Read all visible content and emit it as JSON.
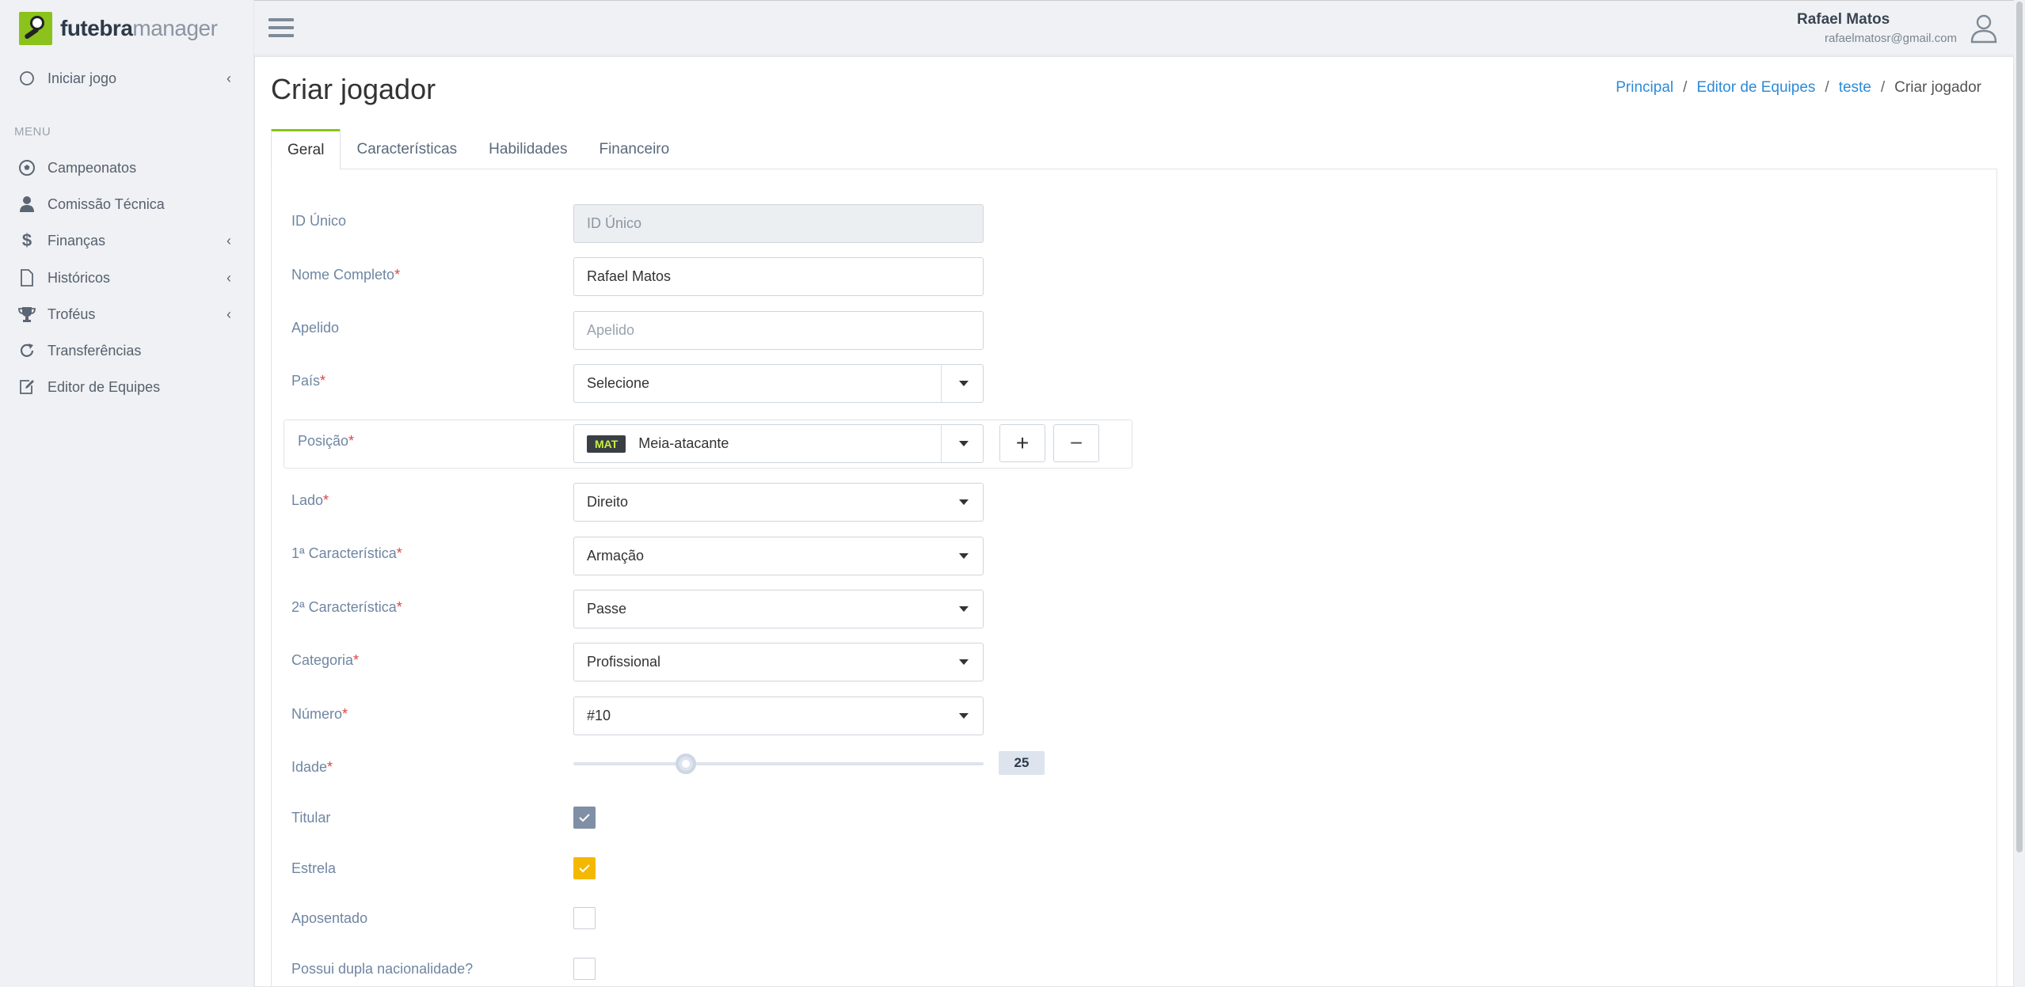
{
  "app": {
    "logo_bold": "futebra",
    "logo_light": "manager"
  },
  "sidebar": {
    "start_game": "Iniciar jogo",
    "menu_header": "MENU",
    "items": [
      {
        "label": "Campeonatos",
        "icon": "soccer-ball-icon",
        "has_chevron": false
      },
      {
        "label": "Comissão Técnica",
        "icon": "user-icon",
        "has_chevron": false
      },
      {
        "label": "Finanças",
        "icon": "dollar-icon",
        "has_chevron": true
      },
      {
        "label": "Históricos",
        "icon": "document-icon",
        "has_chevron": true
      },
      {
        "label": "Troféus",
        "icon": "trophy-icon",
        "has_chevron": true
      },
      {
        "label": "Transferências",
        "icon": "refresh-icon",
        "has_chevron": false
      },
      {
        "label": "Editor de Equipes",
        "icon": "edit-icon",
        "has_chevron": false
      }
    ]
  },
  "user": {
    "name": "Rafael Matos",
    "email": "rafaelmatosr@gmail.com"
  },
  "page": {
    "title": "Criar jogador",
    "breadcrumb": [
      "Principal",
      "Editor de Equipes",
      "teste",
      "Criar jogador"
    ]
  },
  "tabs": [
    "Geral",
    "Características",
    "Habilidades",
    "Financeiro"
  ],
  "active_tab": "Geral",
  "form": {
    "id_label": "ID Único",
    "id_placeholder": "ID Único",
    "name_label": "Nome Completo",
    "name_value": "Rafael Matos",
    "nickname_label": "Apelido",
    "nickname_placeholder": "Apelido",
    "country_label": "País",
    "country_value": "Selecione",
    "position_label": "Posição",
    "position_badge": "MAT",
    "position_value": "Meia-atacante",
    "add_symbol": "+",
    "remove_symbol": "−",
    "side_label": "Lado",
    "side_value": "Direito",
    "char1_label": "1ª Característica",
    "char1_value": "Armação",
    "char2_label": "2ª Característica",
    "char2_value": "Passe",
    "category_label": "Categoria",
    "category_value": "Profissional",
    "number_label": "Número",
    "number_value": "#10",
    "age_label": "Idade",
    "age_value": "25",
    "starter_label": "Titular",
    "starter_checked": true,
    "star_label": "Estrela",
    "star_checked": true,
    "retired_label": "Aposentado",
    "retired_checked": false,
    "dual_label": "Possui dupla nacionalidade?",
    "dual_checked": false
  },
  "colors": {
    "accent_green": "#8bc21c",
    "link_blue": "#2d8bd8",
    "label_blue": "#6f86a2",
    "required_red": "#e04343",
    "star_gold": "#f5b800"
  }
}
